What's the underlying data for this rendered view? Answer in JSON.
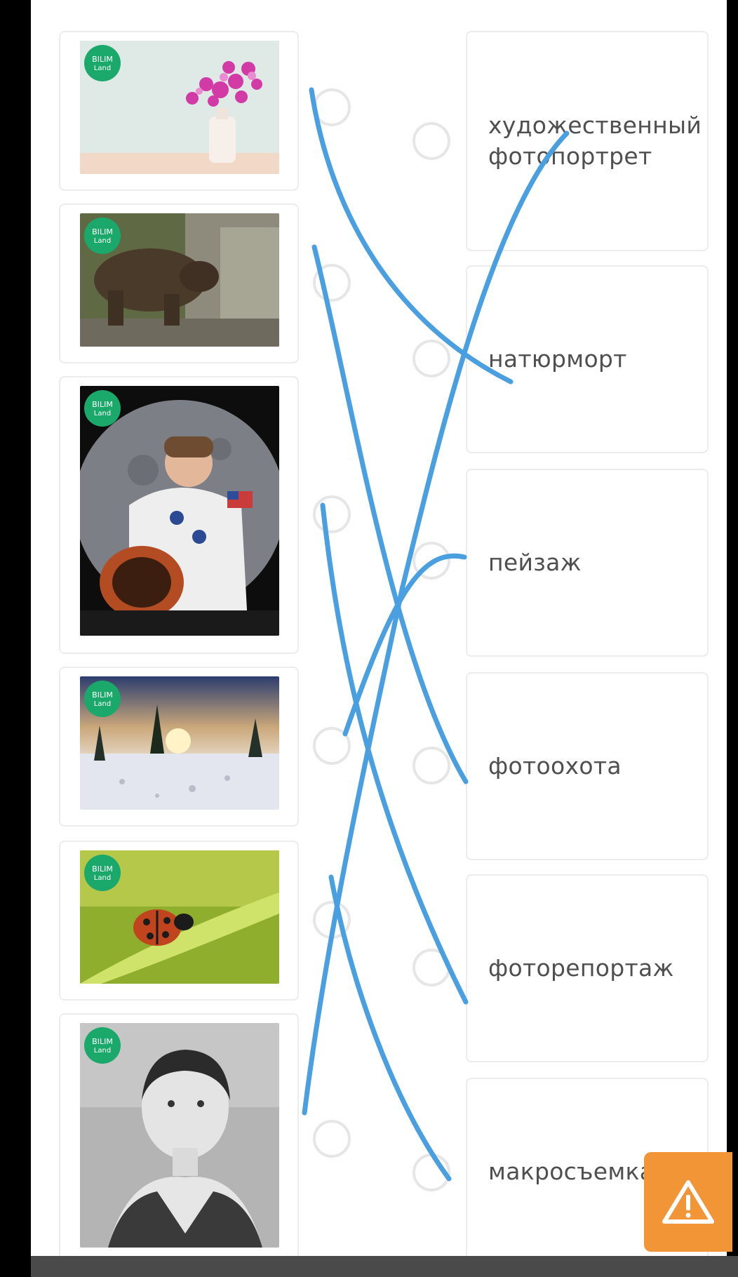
{
  "left_items": [
    {
      "id": "still-life",
      "badge": "BILIM Land"
    },
    {
      "id": "bear",
      "badge": "BILIM Land"
    },
    {
      "id": "astronaut",
      "badge": "BILIM Land"
    },
    {
      "id": "winter",
      "badge": "BILIM Land"
    },
    {
      "id": "ladybug",
      "badge": "BILIM Land"
    },
    {
      "id": "woman-portrait",
      "badge": "BILIM Land"
    }
  ],
  "right_items": [
    {
      "label": "художественный фотопортрет"
    },
    {
      "label": "натюрморт"
    },
    {
      "label": "пейзаж"
    },
    {
      "label": "фотоохота"
    },
    {
      "label": "фоторепортаж"
    },
    {
      "label": "макросъемка"
    }
  ],
  "alert": {
    "icon": "warning-icon",
    "color": "#f29536"
  },
  "colors": {
    "ink": "#4a9fe0",
    "card_border": "#ececec",
    "text": "#4f4f4f",
    "badge": "#1aa86b"
  }
}
